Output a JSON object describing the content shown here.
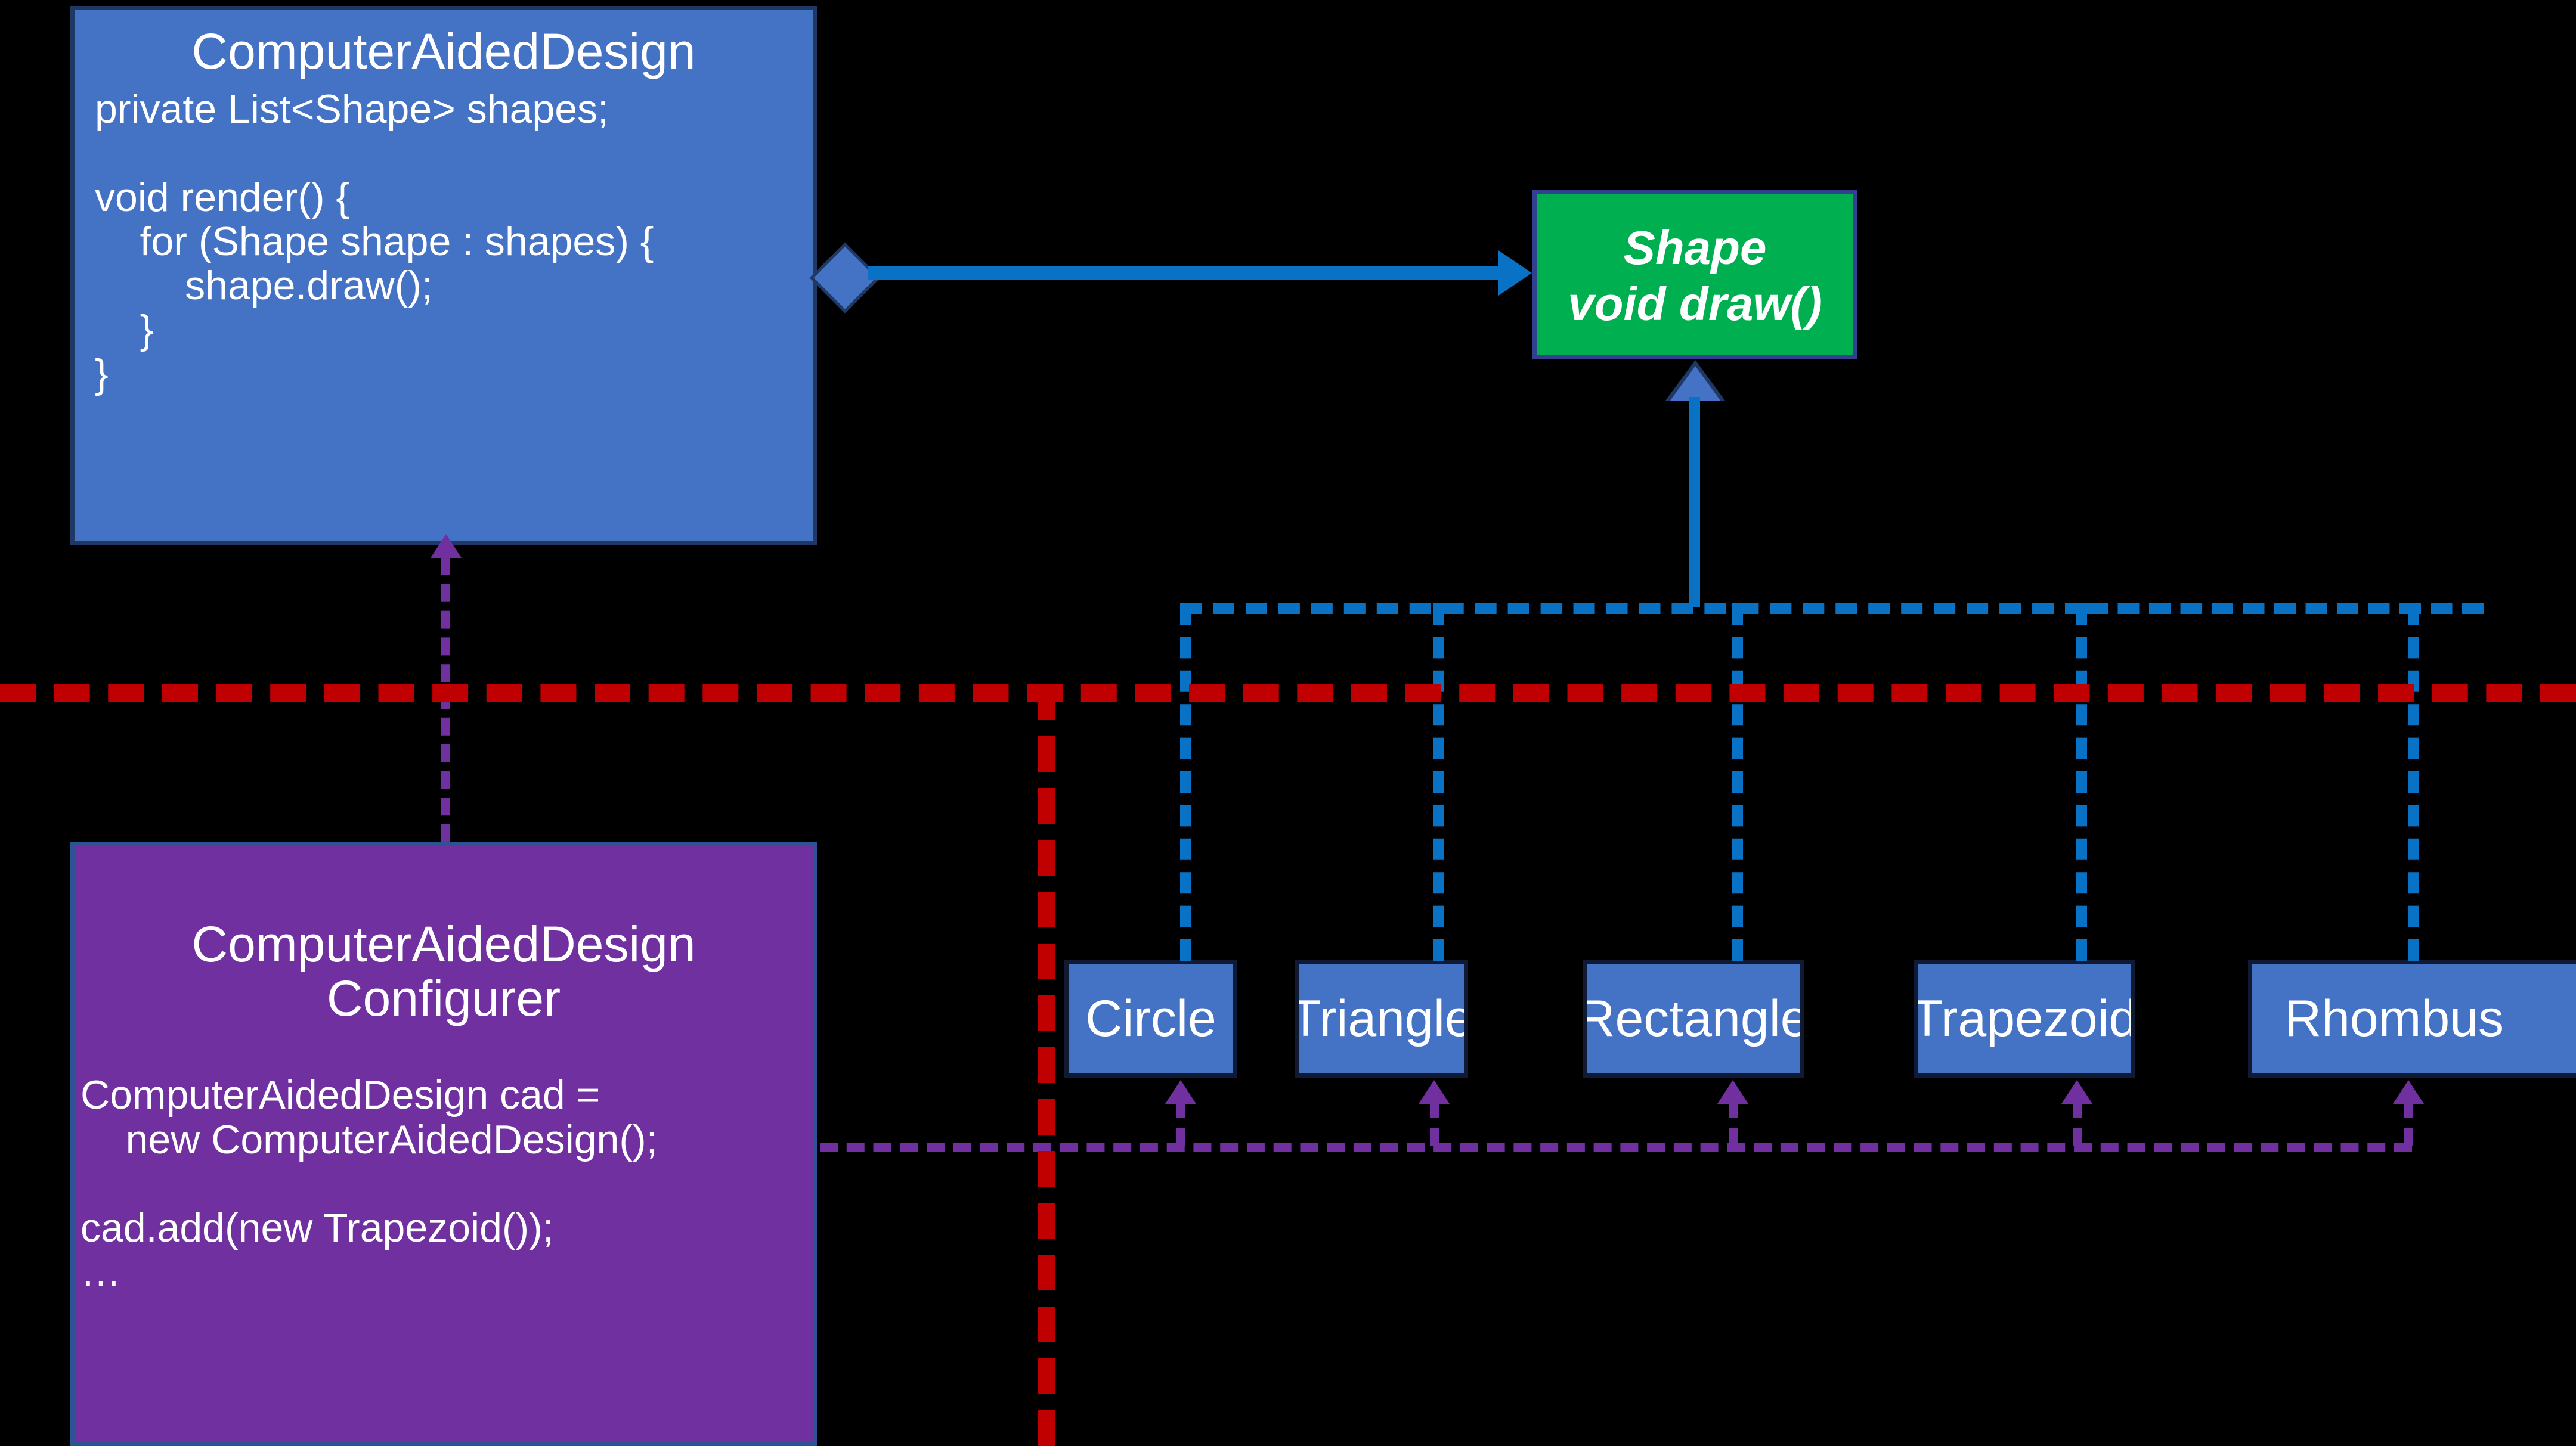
{
  "diagram": {
    "type": "uml-class-diagram",
    "background_color": "#000000",
    "colors": {
      "class_blue": "#4472c4",
      "class_blue_border": "#1f3864",
      "interface_green": "#00b050",
      "interface_green_border": "#333f8f",
      "configurer_purple": "#7030a0",
      "connector_blue": "#0a72c4",
      "connector_purple": "#7030a0",
      "seam_red": "#c00000"
    }
  },
  "cad_class": {
    "title": "ComputerAidedDesign",
    "body": "private List<Shape> shapes;\n\nvoid render() {\n    for (Shape shape : shapes) {\n        shape.draw();\n    }\n}"
  },
  "shape_interface": {
    "text": "Shape\nvoid draw()"
  },
  "configurer_class": {
    "title": "ComputerAidedDesign\nConfigurer",
    "body": "ComputerAidedDesign cad =\n    new ComputerAidedDesign();\n\ncad.add(new Trapezoid());\n…"
  },
  "subclasses": [
    {
      "label": "Circle"
    },
    {
      "label": "Triangle"
    },
    {
      "label": "Rectangle"
    },
    {
      "label": "Trapezoid"
    },
    {
      "label": "Rhombus"
    }
  ],
  "relations": {
    "aggregation": "ComputerAidedDesign aggregates Shape",
    "inheritance": "subclasses implement Shape",
    "dependency": "Configurer depends on ComputerAidedDesign and subclasses",
    "seam": "architectural seam"
  }
}
